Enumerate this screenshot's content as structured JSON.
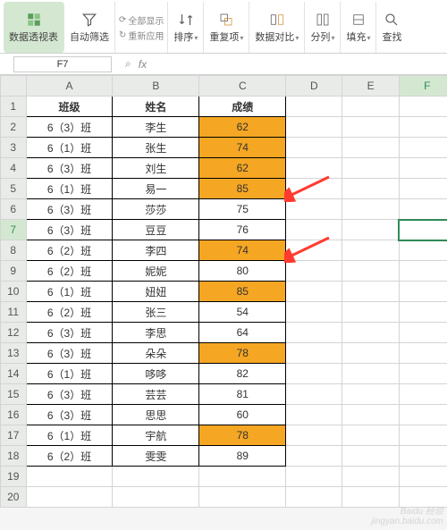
{
  "ribbon": {
    "pivot": "数据透视表",
    "filter": "自动筛选",
    "show_all": "全部显示",
    "reapply": "重新应用",
    "sort": "排序",
    "duplicates": "重复项",
    "compare": "数据对比",
    "split": "分列",
    "fill": "填充",
    "find": "查找"
  },
  "namebox": "F7",
  "fx_label": "fx",
  "columns": [
    "A",
    "B",
    "C",
    "D",
    "E",
    "F"
  ],
  "row_count": 20,
  "selected": {
    "col": "F",
    "row": 7
  },
  "headers": {
    "A": "班级",
    "B": "姓名",
    "C": "成绩"
  },
  "rows": [
    {
      "A": "6（3）班",
      "B": "李生",
      "C": "62",
      "hl": true
    },
    {
      "A": "6（1）班",
      "B": "张生",
      "C": "74",
      "hl": true
    },
    {
      "A": "6（3）班",
      "B": "刘生",
      "C": "62",
      "hl": true
    },
    {
      "A": "6（1）班",
      "B": "易一",
      "C": "85",
      "hl": true
    },
    {
      "A": "6（3）班",
      "B": "莎莎",
      "C": "75",
      "hl": false
    },
    {
      "A": "6（3）班",
      "B": "豆豆",
      "C": "76",
      "hl": false
    },
    {
      "A": "6（2）班",
      "B": "李四",
      "C": "74",
      "hl": true
    },
    {
      "A": "6（2）班",
      "B": "妮妮",
      "C": "80",
      "hl": false
    },
    {
      "A": "6（1）班",
      "B": "妞妞",
      "C": "85",
      "hl": true
    },
    {
      "A": "6（2）班",
      "B": "张三",
      "C": "54",
      "hl": false
    },
    {
      "A": "6（3）班",
      "B": "李思",
      "C": "64",
      "hl": false
    },
    {
      "A": "6（3）班",
      "B": "朵朵",
      "C": "78",
      "hl": true
    },
    {
      "A": "6（1）班",
      "B": "哆哆",
      "C": "82",
      "hl": false
    },
    {
      "A": "6（3）班",
      "B": "芸芸",
      "C": "81",
      "hl": false
    },
    {
      "A": "6（3）班",
      "B": "思思",
      "C": "60",
      "hl": false
    },
    {
      "A": "6（1）班",
      "B": "宇航",
      "C": "78",
      "hl": true
    },
    {
      "A": "6（2）班",
      "B": "雯雯",
      "C": "89",
      "hl": false
    }
  ],
  "watermark": {
    "line1": "Baidu 经验",
    "line2": "jingyan.baidu.com"
  },
  "colors": {
    "highlight": "#f5a623",
    "arrow": "#ff3b30"
  },
  "lens_icon": "⌕"
}
